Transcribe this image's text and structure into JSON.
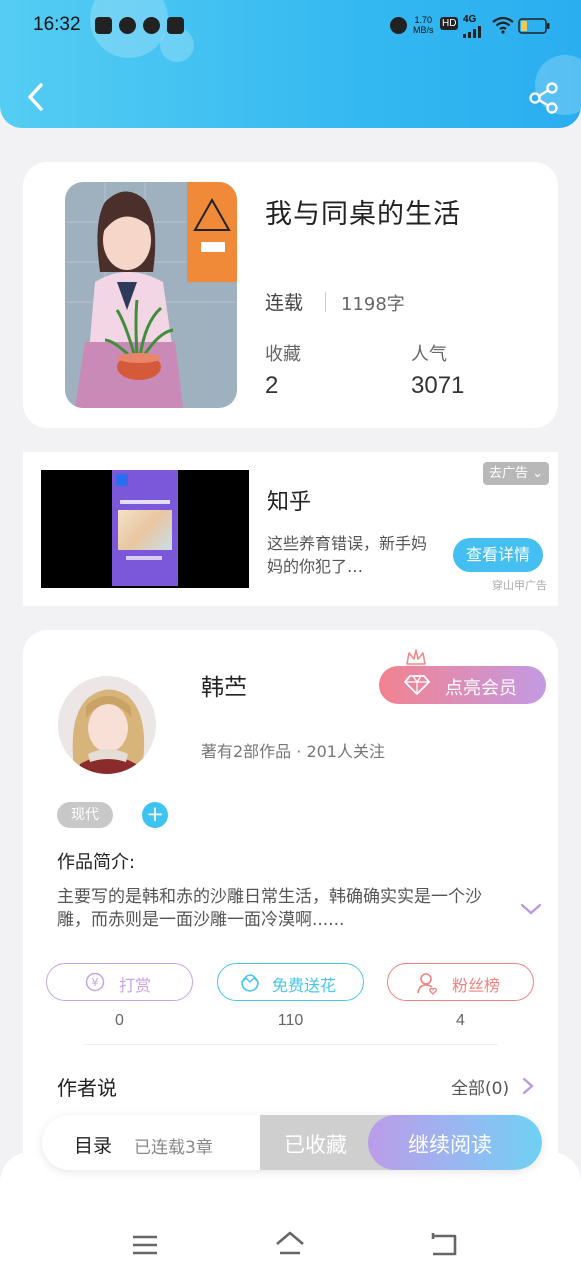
{
  "status_bar": {
    "time": "16:32",
    "speed_value": "1.70",
    "speed_unit": "MB/s",
    "hd": "HD",
    "network": "4G"
  },
  "header": {
    "back_icon": "chevron-left-icon",
    "share_icon": "share-icon"
  },
  "book": {
    "title": "我与同桌的生活",
    "status": "连载",
    "words": "1198字",
    "stats": [
      {
        "label": "收藏",
        "value": "2"
      },
      {
        "label": "人气",
        "value": "3071"
      }
    ]
  },
  "ad": {
    "brand": "知乎",
    "description": "这些养育错误，新手妈妈的你犯了…",
    "close_label": "去广告 ⌄",
    "cta": "查看详情",
    "source": "穿山甲广告"
  },
  "author": {
    "name": "韩苎",
    "meta": "著有2部作品 · 201人关注",
    "vip_button": "点亮会员",
    "tag": "现代",
    "tag_add": "+",
    "intro_heading": "作品简介:",
    "intro_text": "主要写的是韩和赤的沙雕日常生活，韩确确实实是一个沙雕，而赤则是一面沙雕一面冷漠啊......",
    "actions": [
      {
        "label": "打赏",
        "count": "0",
        "color": "#c8a3e6",
        "icon": "coin-icon"
      },
      {
        "label": "免费送花",
        "count": "110",
        "color": "#49c6ec",
        "icon": "flower-icon"
      },
      {
        "label": "粉丝榜",
        "count": "4",
        "color": "#f0837f",
        "icon": "fan-user-icon"
      }
    ],
    "says_heading": "作者说",
    "says_all": "全部(0)"
  },
  "bottom_bar": {
    "toc_label": "目录",
    "toc_status": "已连载3章",
    "collected": "已收藏",
    "read": "继续阅读"
  },
  "colors": {
    "accent_blue": "#35b9f1",
    "vip_gradient_start": "#f3828f",
    "vip_gradient_end": "#c39ae4"
  }
}
